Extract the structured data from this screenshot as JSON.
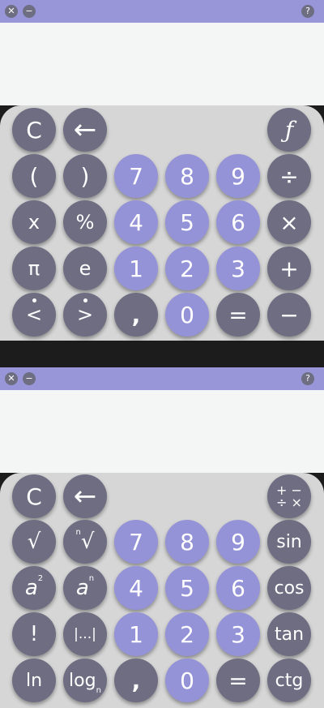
{
  "colors": {
    "titlebar": "#9896d8",
    "display": "#f3f6f4",
    "keypad": "#d6d6d6",
    "key_dark": "#6e6d82",
    "key_number": "#9593d8"
  },
  "window_buttons": {
    "close": "✕",
    "minimize": "−",
    "help": "?"
  },
  "panel_top": {
    "rows": [
      [
        "C",
        "←",
        "ƒ"
      ],
      [
        "(",
        ")",
        "7",
        "8",
        "9",
        "÷"
      ],
      [
        "x",
        "%",
        "4",
        "5",
        "6",
        "×"
      ],
      [
        "π",
        "e",
        "1",
        "2",
        "3",
        "+"
      ],
      [
        "<",
        ">",
        ",",
        "0",
        "=",
        "−"
      ]
    ]
  },
  "panel_bottom": {
    "rows": [
      [
        "C",
        "←",
        "+ −\n÷ ×"
      ],
      [
        "√",
        "√",
        "7",
        "8",
        "9",
        "sin"
      ],
      [
        "a",
        "a",
        "4",
        "5",
        "6",
        "cos"
      ],
      [
        "!",
        "|...|",
        "1",
        "2",
        "3",
        "tan"
      ],
      [
        "ln",
        "log",
        ",",
        "0",
        "=",
        "ctg"
      ]
    ],
    "superscripts": {
      "nth_root": "n",
      "square": "2",
      "power": "n"
    },
    "subscripts": {
      "log_base": "n"
    }
  }
}
